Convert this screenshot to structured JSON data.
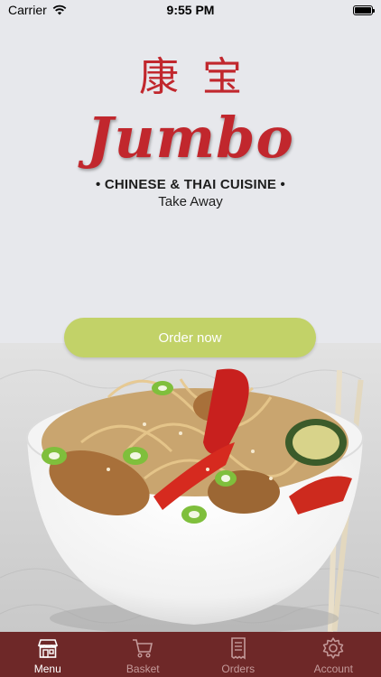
{
  "status_bar": {
    "carrier": "Carrier",
    "time": "9:55 PM"
  },
  "logo": {
    "chinese": "康宝",
    "brand": "Jumbo",
    "cuisine": "• CHINESE & THAI CUISINE •",
    "tagline": "Take Away"
  },
  "order_button": {
    "label": "Order now"
  },
  "tabs": [
    {
      "label": "Menu",
      "icon": "store-icon",
      "active": true
    },
    {
      "label": "Basket",
      "icon": "cart-icon",
      "active": false
    },
    {
      "label": "Orders",
      "icon": "receipt-icon",
      "active": false
    },
    {
      "label": "Account",
      "icon": "gear-icon",
      "active": false
    }
  ],
  "colors": {
    "brand_red": "#c1272d",
    "button_green": "#c2d268",
    "tabbar_bg": "#6e2828",
    "background": "#e7e8ec"
  }
}
